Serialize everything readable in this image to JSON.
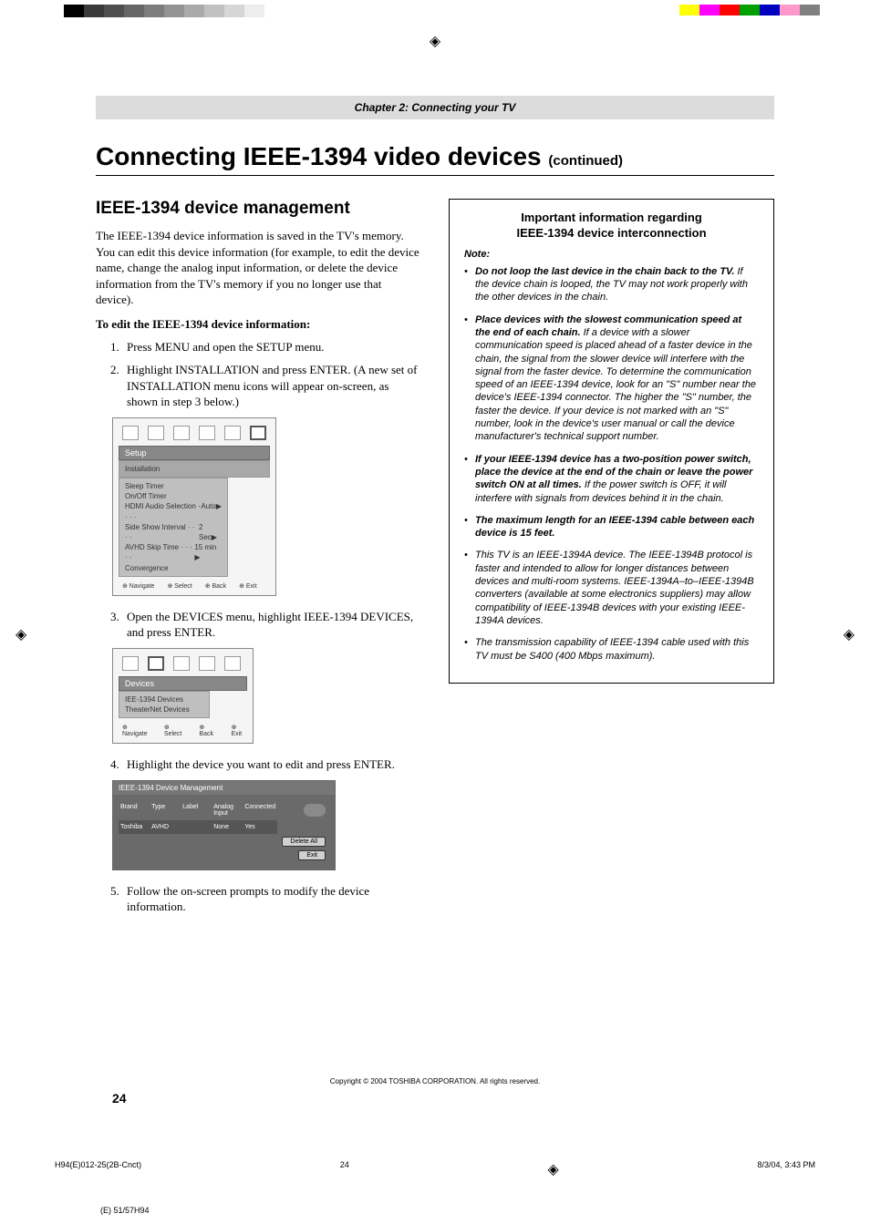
{
  "header": {
    "chapter_label": "Chapter 2: Connecting your TV"
  },
  "title": {
    "main": "Connecting IEEE-1394 video devices ",
    "continued": "(continued)"
  },
  "left_column": {
    "heading": "IEEE-1394 device management",
    "intro": "The IEEE-1394 device information is saved in the TV's memory. You can edit this device information (for example, to edit the device name, change the analog input information, or delete the device information from the TV's memory if you no longer use that device).",
    "edit_label": "To edit the IEEE-1394 device information:",
    "steps": [
      {
        "num": "1.",
        "text": "Press MENU and open the SETUP menu."
      },
      {
        "num": "2.",
        "text": "Highlight INSTALLATION and press ENTER. (A new set of INSTALLATION menu icons will appear on-screen, as shown in step 3 below.)"
      },
      {
        "num": "3.",
        "text": "Open the DEVICES menu, highlight IEEE-1394 DEVICES, and press ENTER."
      },
      {
        "num": "4.",
        "text": "Highlight the device you want to edit and press ENTER."
      },
      {
        "num": "5.",
        "text": "Follow the on-screen prompts to modify the device information."
      }
    ],
    "osd1": {
      "section": "Setup",
      "highlight": "Installation",
      "rows": [
        {
          "l": "Sleep Timer",
          "r": ""
        },
        {
          "l": "On/Off Timer",
          "r": ""
        },
        {
          "l": "HDMI Audio Selection · · · ·",
          "r": "Auto▶"
        },
        {
          "l": "Side Show Interval  · · · ·",
          "r": "2 Sec▶"
        },
        {
          "l": "AVHD Skip Time  · · · · ·",
          "r": "15 min ▶"
        },
        {
          "l": "Convergence",
          "r": ""
        }
      ],
      "nav": [
        "Navigate",
        "Select",
        "Back",
        "Exit"
      ]
    },
    "osd2": {
      "section": "Devices",
      "rows": [
        {
          "l": "IEE-1394 Devices",
          "r": ""
        },
        {
          "l": "TheaterNet Devices",
          "r": ""
        }
      ],
      "nav": [
        "Navigate",
        "Select",
        "Back",
        "Exit"
      ]
    },
    "osd3": {
      "title": "IEEE-1394 Device Management",
      "headers": [
        "Brand",
        "Type",
        "Label",
        "Analog Input",
        "Connected"
      ],
      "row": [
        "Toshiba",
        "AVHD",
        "",
        "None",
        "Yes"
      ],
      "buttons": [
        "Delete All",
        "Exit"
      ]
    }
  },
  "right_column": {
    "box_title_l1": "Important information regarding",
    "box_title_l2": "IEEE-1394 device interconnection",
    "note_label": "Note:",
    "notes": [
      {
        "lead": "Do not loop the last device in the chain back to the TV.",
        "rest": " If the device chain is looped, the TV may not work properly with the other devices in the chain."
      },
      {
        "lead": "Place devices with the slowest communication speed at the end of each chain.",
        "rest": " If a device with a slower communication speed is placed ahead of a faster device in the chain, the signal from the slower device will interfere with the signal from the faster device. To determine the communication speed of an IEEE-1394 device, look for an \"S\" number near the device's IEEE-1394 connector. The higher the \"S\" number, the faster the device. If your device is not marked with an \"S\" number, look in the device's user manual or call the device manufacturer's technical support number."
      },
      {
        "lead": "If your IEEE-1394 device has a two-position power switch, place the device at the end of the chain or leave the power switch ON at all times.",
        "rest": " If the power switch is OFF, it will interfere with signals from devices behind it in the chain."
      },
      {
        "lead": "The maximum length for an IEEE-1394 cable between each device is 15 feet.",
        "rest": ""
      },
      {
        "lead": "",
        "rest": "This TV is an IEEE-1394A device. The IEEE-1394B protocol is faster and intended to allow for longer distances between devices and multi-room systems. IEEE-1394A–to–IEEE-1394B converters (available at some electronics suppliers) may allow compatibility of IEEE-1394B devices with your existing IEEE-1394A devices."
      },
      {
        "lead": "",
        "rest": "The transmission capability of IEEE-1394 cable used with this TV must be S400 (400 Mbps maximum)."
      }
    ]
  },
  "footer": {
    "copyright": "Copyright © 2004 TOSHIBA CORPORATION. All rights reserved.",
    "page_number": "24",
    "print_left": "H94(E)012-25(2B-Cnct)",
    "print_center": "24",
    "print_right": "8/3/04, 3:43 PM",
    "bottom_code": "(E) 51/57H94"
  },
  "color_bars_left": [
    "#000",
    "#3a3a3a",
    "#4f4f4f",
    "#666",
    "#7d7d7d",
    "#939393",
    "#aaa",
    "#c0c0c0",
    "#d6d6d6",
    "#ededed"
  ],
  "color_bars_right": [
    "#ffff00",
    "#ff00ff",
    "#ff0000",
    "#00a000",
    "#0000c0",
    "#ff99cc",
    "#808080"
  ]
}
